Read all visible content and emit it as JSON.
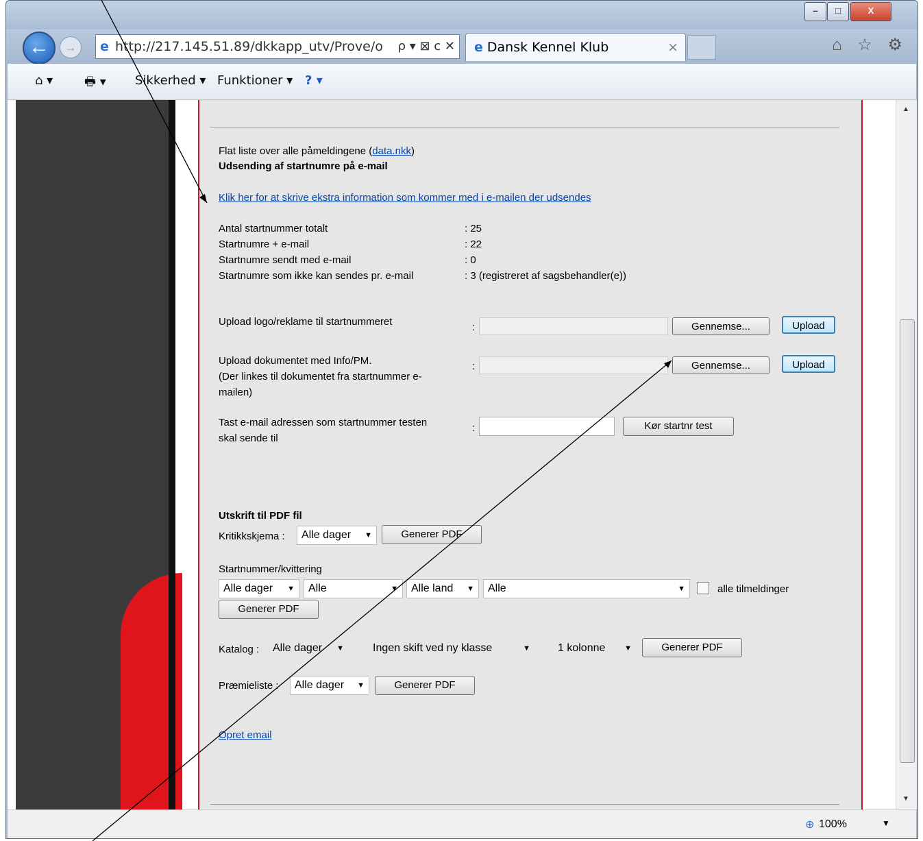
{
  "window": {
    "minimize": "–",
    "maximize": "□",
    "close": "X"
  },
  "browser": {
    "address": "http://217.145.51.89/dkkapp_utv/Prove/o",
    "address_tools": "ρ ▾ ⊠ c ✕",
    "tab_title": "Dansk Kennel Klub",
    "tab_close": "×",
    "top_icons": "⌂ ☆ ⚙"
  },
  "commandbar": {
    "home": "⌂ ▾",
    "print": "🖶 ▾",
    "security": "Sikkerhed ▾",
    "tools": "Funktioner ▾",
    "help": "? ▾"
  },
  "page": {
    "flat_list_text": "Flat liste over alle påmeldingene (",
    "flat_list_link": "data.nkk",
    "flat_list_close": ")",
    "email_heading": "Udsending af startnumre på e-mail",
    "extra_info_link": "Klik her for at skrive ekstra information som kommer med i e-mailen der udsendes",
    "stats": [
      {
        "label": "Antal startnummer totalt",
        "value": ": 25"
      },
      {
        "label": "Startnumre + e-mail",
        "value": ": 22"
      },
      {
        "label": "Startnumre sendt med e-mail",
        "value": ": 0"
      },
      {
        "label": "Startnumre som ikke kan sendes pr. e-mail",
        "value": ": 3  (registreret af sagsbehandler(e))"
      }
    ],
    "upload_logo_label": "Upload logo/reklame til startnummeret",
    "upload_doc_label1": "Upload dokumentet med Info/PM.",
    "upload_doc_label2": "(Der linkes til dokumentet fra startnummer e-",
    "upload_doc_label3": "mailen)",
    "colon": ":",
    "browse": "Gennemse...",
    "upload": "Upload",
    "test_label1": "Tast e-mail adressen som startnummer testen",
    "test_label2": "skal sende til",
    "test_button": "Kør startnr test",
    "pdf_heading": "Utskrift til PDF fil",
    "kritikk_label": "Kritikkskjema :",
    "kritikk_select": "Alle dager",
    "generate_pdf": "Generer PDF",
    "startnr_label": "Startnummer/kvittering",
    "startnr_days": "Alle dager",
    "startnr_alle": "Alle",
    "startnr_land": "Alle land",
    "startnr_alle2": "Alle",
    "alle_tilmeldinger": "alle tilmeldinger",
    "katalog_label": "Katalog :",
    "katalog_days": "Alle dager",
    "katalog_skift": "Ingen skift ved ny klasse",
    "katalog_kolonne": "1 kolonne",
    "premie_label": "Præmieliste :",
    "premie_days": "Alle dager",
    "opret_email": "Opret email"
  },
  "status": {
    "zoom": "100%"
  }
}
